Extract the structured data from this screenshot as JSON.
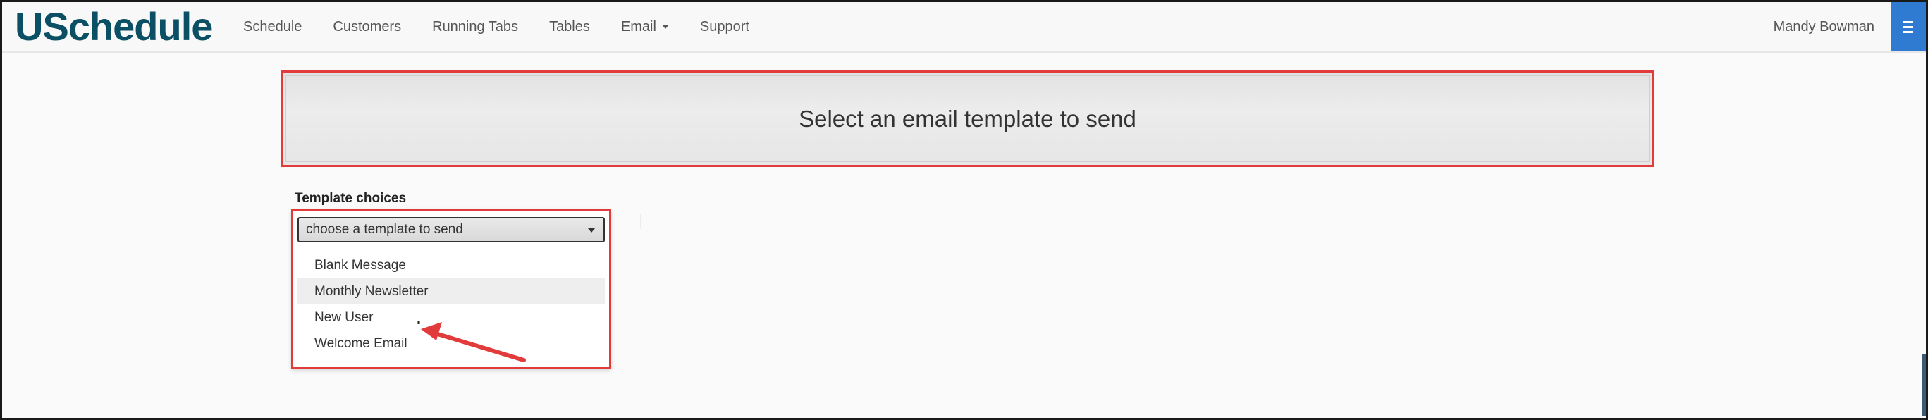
{
  "app": {
    "logo": "USchedule"
  },
  "nav": {
    "items": [
      {
        "label": "Schedule"
      },
      {
        "label": "Customers"
      },
      {
        "label": "Running Tabs"
      },
      {
        "label": "Tables"
      },
      {
        "label": "Email"
      },
      {
        "label": "Support"
      }
    ],
    "user_name": "Mandy Bowman",
    "menu_icon": "hamburger-menu-icon"
  },
  "page": {
    "heading": "Select an email template to send"
  },
  "template": {
    "label": "Template choices",
    "selected": "choose a template to send",
    "options": [
      {
        "label": "Blank Message"
      },
      {
        "label": "Monthly Newsletter"
      },
      {
        "label": "New User"
      },
      {
        "label": "Welcome Email"
      }
    ]
  },
  "colors": {
    "brand": "#0a4f63",
    "accent": "#2f7bd1",
    "highlight_border": "#e23b3b"
  }
}
